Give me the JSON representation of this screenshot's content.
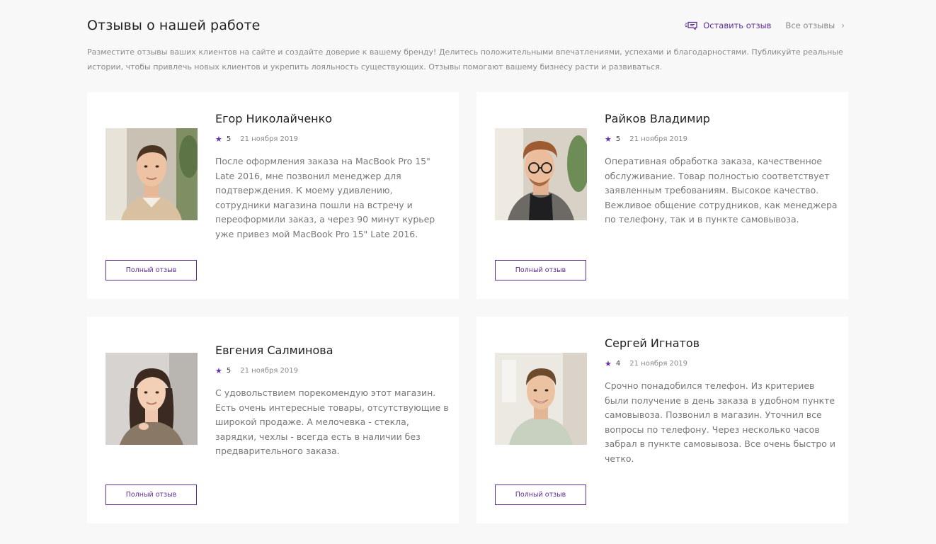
{
  "header": {
    "title": "Отзывы о нашей работе",
    "leave_review": "Оставить отзыв",
    "all_reviews": "Все отзывы"
  },
  "description": "Разместите отзывы ваших клиентов на сайте и создайте доверие к вашему бренду! Делитесь положительными впечатлениями, успехами и благодарностями. Публикуйте реальные истории, чтобы привлечь новых клиентов и укрепить лояльность существующих. Отзывы помогают вашему бизнесу расти и развиваться.",
  "reviews": [
    {
      "name": "Егор Николайченко",
      "rating": "5",
      "date": "21 ноября 2019",
      "text": "После оформления заказа на MacBook Pro 15\" Late 2016, мне позвонил менеджер для подтверждения. К моему удивлению, сотрудники магазина пошли на встречу и переоформили заказ, а через 90 минут курьер уже привез мой MacBook Pro 15\" Late 2016.",
      "button": "Полный отзыв"
    },
    {
      "name": "Райков Владимир",
      "rating": "5",
      "date": "21 ноября 2019",
      "text": "Оперативная обработка заказа, качественное обслуживание. Товар полностью соответствует заявленным требованиям. Высокое качество. Вежливое общение сотрудников, как менеджера по телефону, так и в пункте самовывоза.",
      "button": "Полный отзыв"
    },
    {
      "name": "Евгения Салминова",
      "rating": "5",
      "date": "21 ноября 2019",
      "text": "С удовольствием порекомендую этот магазин. Есть очень интересные товары, отсутствующие в широкой продаже. А мелочевка - стекла, зарядки, чехлы - всегда есть в наличии без предварительного заказа.",
      "button": "Полный отзыв"
    },
    {
      "name": "Сергей Игнатов",
      "rating": "4",
      "date": "21 ноября 2019",
      "text": "Срочно понадобился телефон. Из критериев были получение в день заказа в удобном пункте самовывоза. Позвонил в магазин. Уточнил все вопросы по телефону. Через несколько часов забрал в пункте самовывоза. Все очень быстро и четко.",
      "button": "Полный отзыв"
    }
  ],
  "colors": {
    "accent": "#5b2c96",
    "star": "#6a2fb1",
    "background": "#f8f8f8"
  },
  "icons": {
    "leave_review": "review-icon",
    "all_reviews": "chevron-right-icon",
    "rating": "star-icon"
  }
}
